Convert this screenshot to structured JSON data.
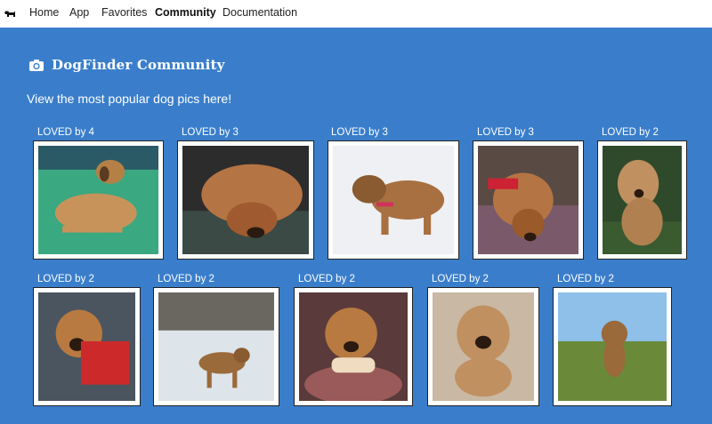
{
  "nav": {
    "brand_icon": "dog-icon",
    "items": [
      {
        "label": "Home",
        "active": false
      },
      {
        "label": "App",
        "active": false
      },
      {
        "label": "Favorites",
        "active": false
      },
      {
        "label": "Community",
        "active": true
      },
      {
        "label": "Documentation",
        "active": false
      }
    ]
  },
  "header": {
    "icon": "camera-icon",
    "title": "DogFinder Community",
    "subtitle": "View the most popular dog pics here!"
  },
  "colors": {
    "background": "#3a7ecb",
    "nav_background": "#ffffff"
  },
  "gallery": {
    "rows": [
      [
        {
          "loved": "LOVED by 4"
        },
        {
          "loved": "LOVED by 3"
        },
        {
          "loved": "LOVED by 3"
        },
        {
          "loved": "LOVED by 3"
        },
        {
          "loved": "LOVED by 2"
        }
      ],
      [
        {
          "loved": "LOVED by 2"
        },
        {
          "loved": "LOVED by 2"
        },
        {
          "loved": "LOVED by 2"
        },
        {
          "loved": "LOVED by 2"
        },
        {
          "loved": "LOVED by 2"
        }
      ]
    ]
  }
}
